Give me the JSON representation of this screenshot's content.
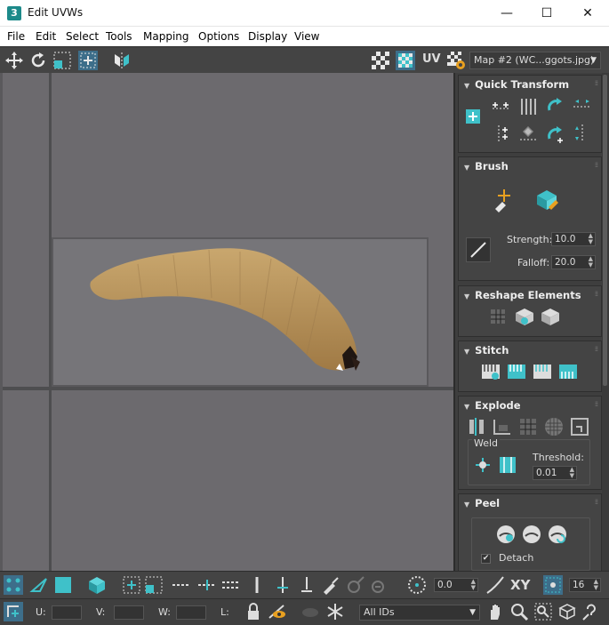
{
  "window": {
    "app_icon": "3",
    "title": "Edit UVWs",
    "minimize_glyph": "—",
    "maximize_glyph": "☐",
    "close_glyph": "✕"
  },
  "menu": [
    "File",
    "Edit",
    "Select",
    "Tools",
    "Mapping",
    "Options",
    "Display",
    "View"
  ],
  "toolbar": {
    "uv_label": "UV",
    "map_dropdown": "Map #2 (WC...ggots.jpg)"
  },
  "panels": {
    "quick_transform": {
      "title": "Quick Transform"
    },
    "brush": {
      "title": "Brush",
      "strength_label": "Strength:",
      "strength_value": "10.0",
      "falloff_label": "Falloff:",
      "falloff_value": "20.0"
    },
    "reshape": {
      "title": "Reshape Elements"
    },
    "stitch": {
      "title": "Stitch"
    },
    "explode": {
      "title": "Explode",
      "weld_label": "Weld",
      "threshold_label": "Threshold:",
      "threshold_value": "0.01"
    },
    "peel": {
      "title": "Peel",
      "detach_label": "Detach",
      "detach_checked": true
    }
  },
  "bottom": {
    "angle_value": "0.0",
    "xy_label": "XY",
    "grid_value": "16",
    "u_label": "U:",
    "v_label": "V:",
    "w_label": "W:",
    "l_label": "L:",
    "ids_value": "All IDs"
  },
  "colors": {
    "accent": "#3fc1c9",
    "viewport_bg": "#6c6a6e",
    "panel_bg": "#444444"
  }
}
